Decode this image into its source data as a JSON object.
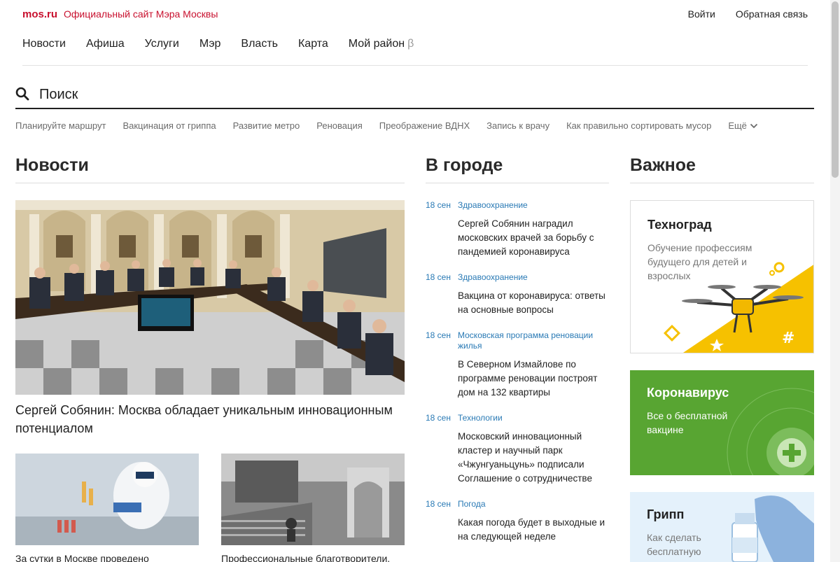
{
  "header": {
    "logo": "mos.ru",
    "slogan": "Официальный сайт Мэра Москвы",
    "login": "Войти",
    "feedback": "Обратная связь"
  },
  "nav": {
    "items": [
      "Новости",
      "Афиша",
      "Услуги",
      "Мэр",
      "Власть",
      "Карта",
      "Мой район"
    ],
    "beta": "β"
  },
  "search": {
    "placeholder": "Поиск"
  },
  "quick_links": {
    "items": [
      "Планируйте маршрут",
      "Вакцинация от гриппа",
      "Развитие метро",
      "Реновация",
      "Преображение ВДНХ",
      "Запись к врачу",
      "Как правильно сортировать мусор"
    ],
    "more": "Ещё"
  },
  "news": {
    "title": "Новости",
    "main_caption": "Сергей Собянин: Москва обладает уникальным инновационным потенциалом",
    "small": [
      {
        "caption": "За сутки в Москве проведено"
      },
      {
        "caption": "Профессиональные благотворители."
      }
    ]
  },
  "city": {
    "title": "В городе",
    "items": [
      {
        "date": "18 сен",
        "category": "Здравоохранение",
        "text": "Сергей Собянин наградил московских врачей за борьбу с пандемией коронавируса"
      },
      {
        "date": "18 сен",
        "category": "Здравоохранение",
        "text": "Вакцина от коронавируса: ответы на основные вопросы"
      },
      {
        "date": "18 сен",
        "category": "Московская программа реновации жилья",
        "text": "В Северном Измайлове по программе реновации построят дом на 132 квартиры"
      },
      {
        "date": "18 сен",
        "category": "Технологии",
        "text": "Московский инновационный кластер и научный парк «Чжунгуаньцунь» подписали Соглашение о сотрудничестве"
      },
      {
        "date": "18 сен",
        "category": "Погода",
        "text": "Какая погода будет в выходные и на следующей неделе"
      }
    ]
  },
  "important": {
    "title": "Важное",
    "cards": [
      {
        "title": "Техноград",
        "subtitle": "Обучение профессиям будущего для детей и взрослых"
      },
      {
        "title": "Коронавирус",
        "subtitle": "Все о бесплатной вакцине"
      },
      {
        "title": "Грипп",
        "subtitle": "Как сделать бесплатную"
      }
    ]
  },
  "colors": {
    "brand_red": "#c8102e",
    "link_blue": "#2a7ab5",
    "covid_green": "#58a532",
    "flu_blue": "#e4f1fb",
    "techno_yellow": "#f6c100"
  }
}
